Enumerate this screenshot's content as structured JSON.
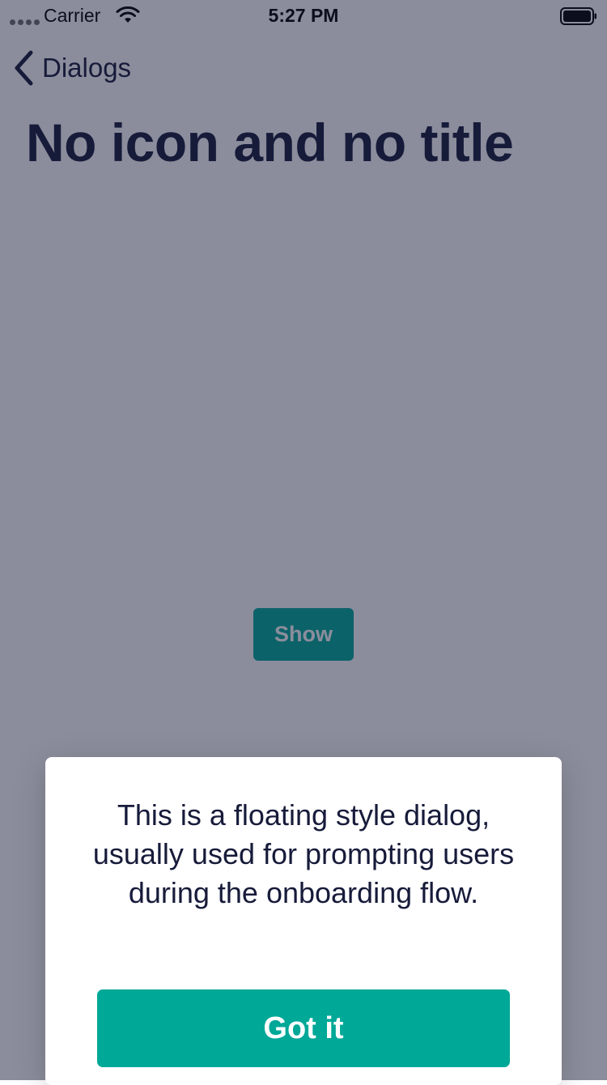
{
  "status_bar": {
    "carrier": "Carrier",
    "time": "5:27 PM"
  },
  "nav": {
    "back_label": "Dialogs"
  },
  "page": {
    "title": "No icon and no title",
    "show_button_label": "Show"
  },
  "dialog": {
    "message": "This is a floating style dialog, usually used for prompting users during the onboarding flow.",
    "primary_button_label": "Got it"
  },
  "colors": {
    "ink": "#171b3a",
    "accent": "#00a898",
    "overlay": "rgba(23,27,58,0.5)"
  },
  "icons": [
    "signal-dots-icon",
    "wifi-icon",
    "battery-icon",
    "chevron-left-icon"
  ]
}
